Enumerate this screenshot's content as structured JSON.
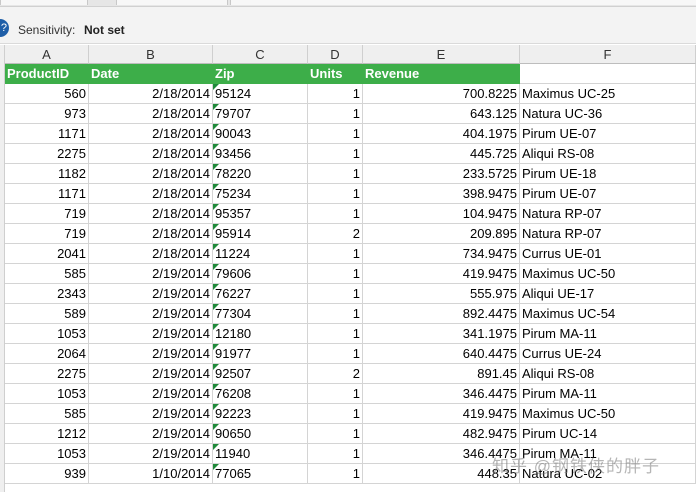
{
  "sensitivity": {
    "label": "Sensitivity:",
    "value": "Not set"
  },
  "columns": [
    "A",
    "B",
    "C",
    "D",
    "E",
    "F"
  ],
  "header": [
    "ProductID",
    "Date",
    "Zip",
    "Units",
    "Revenue",
    ""
  ],
  "rows": [
    [
      "560",
      "2/18/2014",
      "95124",
      "1",
      "700.8225",
      "Maximus UC-25"
    ],
    [
      "973",
      "2/18/2014",
      "79707",
      "1",
      "643.125",
      "Natura UC-36"
    ],
    [
      "1171",
      "2/18/2014",
      "90043",
      "1",
      "404.1975",
      "Pirum UE-07"
    ],
    [
      "2275",
      "2/18/2014",
      "93456",
      "1",
      "445.725",
      "Aliqui RS-08"
    ],
    [
      "1182",
      "2/18/2014",
      "78220",
      "1",
      "233.5725",
      "Pirum UE-18"
    ],
    [
      "1171",
      "2/18/2014",
      "75234",
      "1",
      "398.9475",
      "Pirum UE-07"
    ],
    [
      "719",
      "2/18/2014",
      "95357",
      "1",
      "104.9475",
      "Natura RP-07"
    ],
    [
      "719",
      "2/18/2014",
      "95914",
      "2",
      "209.895",
      "Natura RP-07"
    ],
    [
      "2041",
      "2/18/2014",
      "11224",
      "1",
      "734.9475",
      "Currus UE-01"
    ],
    [
      "585",
      "2/19/2014",
      "79606",
      "1",
      "419.9475",
      "Maximus UC-50"
    ],
    [
      "2343",
      "2/19/2014",
      "76227",
      "1",
      "555.975",
      "Aliqui UE-17"
    ],
    [
      "589",
      "2/19/2014",
      "77304",
      "1",
      "892.4475",
      "Maximus UC-54"
    ],
    [
      "1053",
      "2/19/2014",
      "12180",
      "1",
      "341.1975",
      "Pirum MA-11"
    ],
    [
      "2064",
      "2/19/2014",
      "91977",
      "1",
      "640.4475",
      "Currus UE-24"
    ],
    [
      "2275",
      "2/19/2014",
      "92507",
      "2",
      "891.45",
      "Aliqui RS-08"
    ],
    [
      "1053",
      "2/19/2014",
      "76208",
      "1",
      "346.4475",
      "Pirum MA-11"
    ],
    [
      "585",
      "2/19/2014",
      "92223",
      "1",
      "419.9475",
      "Maximus UC-50"
    ],
    [
      "1212",
      "2/19/2014",
      "90650",
      "1",
      "482.9475",
      "Pirum UC-14"
    ],
    [
      "1053",
      "2/19/2014",
      "11940",
      "1",
      "346.4475",
      "Pirum MA-11"
    ],
    [
      "939",
      "1/10/2014",
      "77065",
      "1",
      "448.35",
      "Natura UC-02"
    ]
  ],
  "watermark": "知乎 @钢铁侠的胖子"
}
